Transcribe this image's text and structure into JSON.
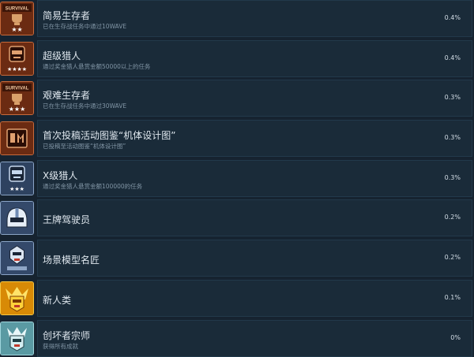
{
  "achievements": [
    {
      "title": "简易生存者",
      "desc": "已在生存战任务中通过10WAVE",
      "percent": "0.4%",
      "icon": "survival-two-star-icon",
      "badge_text": "SURVIVAL",
      "stars": "★★"
    },
    {
      "title": "超级猎人",
      "desc": "通过奖金猎人悬赏金额50000以上的任务",
      "percent": "0.4%",
      "icon": "hunter-four-star-icon",
      "stars": "★★★★"
    },
    {
      "title": "艰难生存者",
      "desc": "已在生存战任务中通过30WAVE",
      "percent": "0.3%",
      "icon": "survival-three-star-icon",
      "badge_text": "SURVIVAL",
      "stars": "★★★"
    },
    {
      "title": "首次投稿活动图鉴“机体设计图”",
      "desc": "已投稿至活动图鉴“机体设计图”",
      "percent": "0.3%",
      "icon": "blueprint-book-icon"
    },
    {
      "title": "X级猎人",
      "desc": "通过奖金猎人悬赏金额100000的任务",
      "percent": "0.3%",
      "icon": "hunter-x-rank-icon",
      "stars": "★★★"
    },
    {
      "title": "王牌驾驶员",
      "percent": "0.2%",
      "icon": "pilot-helmet-icon"
    },
    {
      "title": "场景模型名匠",
      "percent": "0.2%",
      "icon": "diorama-gundam-icon"
    },
    {
      "title": "新人类",
      "percent": "0.1%",
      "icon": "gold-gundam-head-icon"
    },
    {
      "title": "创坏者宗师",
      "desc": "获得所有成就",
      "percent": "0%",
      "icon": "master-gundam-icon"
    }
  ]
}
